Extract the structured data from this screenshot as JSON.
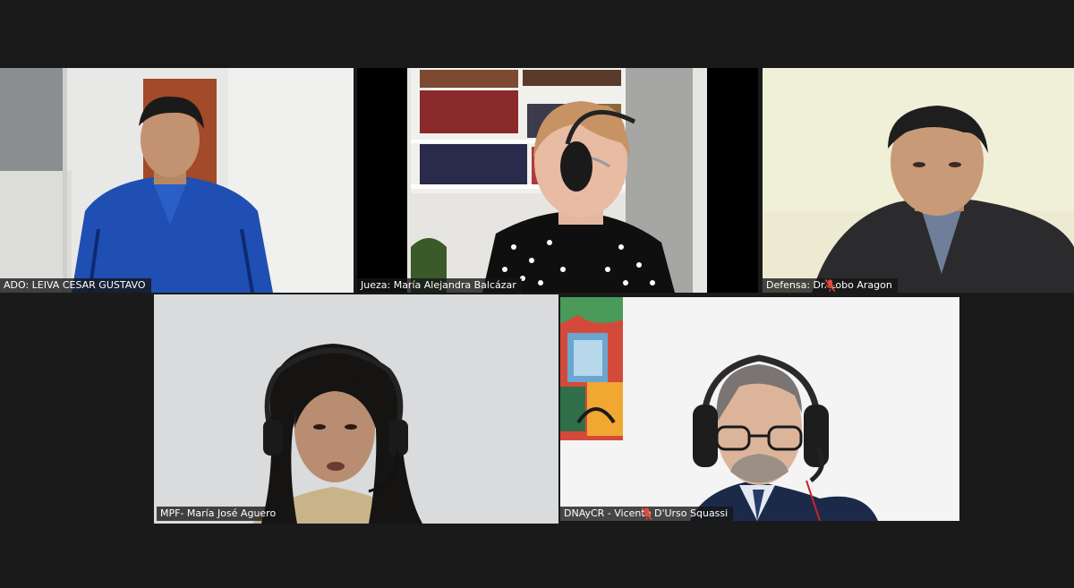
{
  "participants": [
    {
      "label": "ADO: LEIVA CESAR GUSTAVO",
      "muted": false,
      "speaking": false
    },
    {
      "label": "Jueza: María Alejandra Balcázar",
      "muted": false,
      "speaking": false
    },
    {
      "label": "Defensa: Dr. Lobo Aragon",
      "muted": true,
      "speaking": false
    },
    {
      "label": "MPF- María José Aguero",
      "muted": false,
      "speaking": true
    },
    {
      "label": "DNAyCR - Vicente D'Urso Squassi",
      "muted": true,
      "speaking": false
    }
  ],
  "colors": {
    "background": "#1a1a1a",
    "active_speaker_border": "#b8d86a",
    "muted_icon": "#e04a3a"
  }
}
